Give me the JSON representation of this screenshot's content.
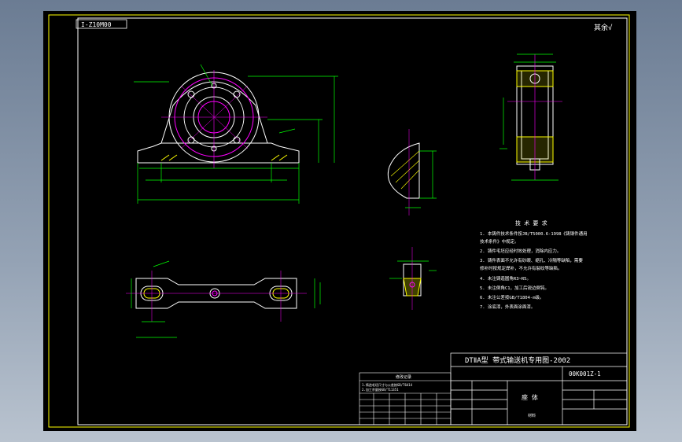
{
  "drawing": {
    "code_tag": "I-Z10M00",
    "roughness": "其余√",
    "project_title": "DTⅡA型 带式输送机专用图-2002",
    "drawing_number": "00K001Z-1",
    "part_name": "座 体",
    "title_sub": "材料",
    "tech_req_title": "技 术 要 求",
    "tech_req_lines": [
      "1. 本铸件技术条件按JB/T5000.6-1998《铸钢件通用",
      "   技术条件》中规定。",
      "2. 铸件毛坯应经时效处理，消除内应力。",
      "3. 铸件表面不允许有砂眼、缩孔、冷隔等缺陷，需要",
      "   修补时按规定焊补，不允许有裂纹等缺陷。",
      "4. 未注铸造圆角R3~R5。",
      "5. 未注倒角C1，加工后锐边倒钝。",
      "6. 未注公差按GB/T1804-m级。",
      "7. 涂底漆，外表面涂面漆。"
    ],
    "change_block_title": "修改记录",
    "change_lines": [
      "1.铸造毛坯尺寸与公差按GB/T6414",
      "2.加工余量按GB/T11351"
    ],
    "colors": {
      "frame": "#ffff00",
      "outline": "#ffffff",
      "dimension": "#00ff00",
      "hatch": "#ffff00",
      "center": "#ff00ff",
      "text": "#ffffff"
    }
  }
}
